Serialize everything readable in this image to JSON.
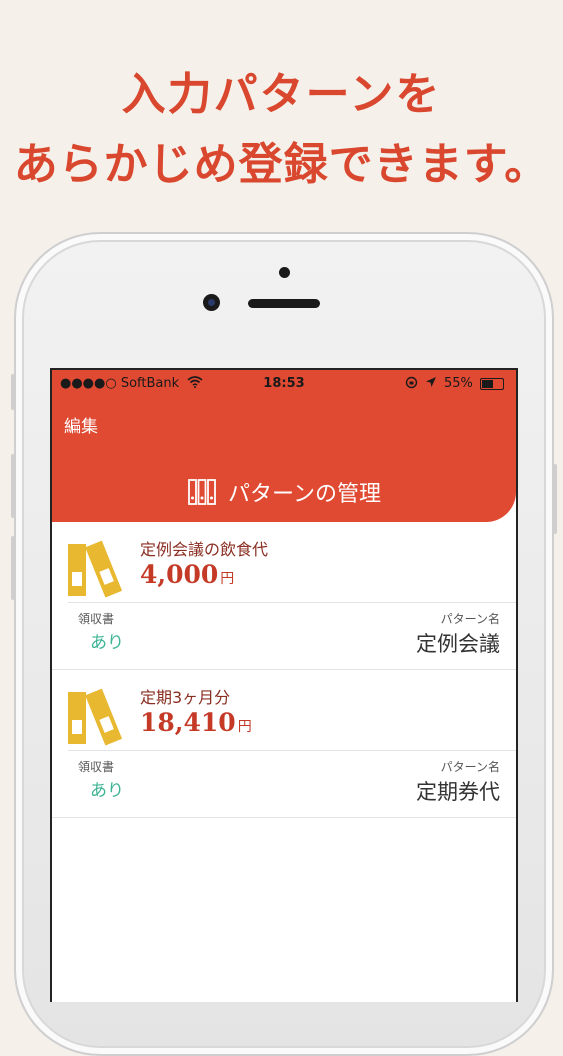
{
  "promo": {
    "line1": "入力パターンを",
    "line2": "あらかじめ登録できます。"
  },
  "status_bar": {
    "carrier": "●●●●○ SoftBank",
    "time": "18:53",
    "battery": "55%",
    "battery_level": 0.55
  },
  "nav": {
    "edit_label": "編集",
    "title": "パターンの管理"
  },
  "patterns": [
    {
      "name": "定例会議の飲食代",
      "amount": "4,000",
      "currency": "円",
      "receipt_label": "領収書",
      "receipt_value": "あり",
      "pattern_label": "パターン名",
      "pattern_value": "定例会議"
    },
    {
      "name": "定期3ヶ月分",
      "amount": "18,410",
      "currency": "円",
      "receipt_label": "領収書",
      "receipt_value": "あり",
      "pattern_label": "パターン名",
      "pattern_value": "定期券代"
    }
  ],
  "colors": {
    "accent": "#e04a32",
    "background": "#f5f1ea",
    "amount": "#c43a26",
    "receipt": "#3eb495",
    "folder": "#e8b830"
  },
  "icons": [
    "binders-icon",
    "folder-icon",
    "wifi-icon",
    "location-icon",
    "battery-icon"
  ]
}
